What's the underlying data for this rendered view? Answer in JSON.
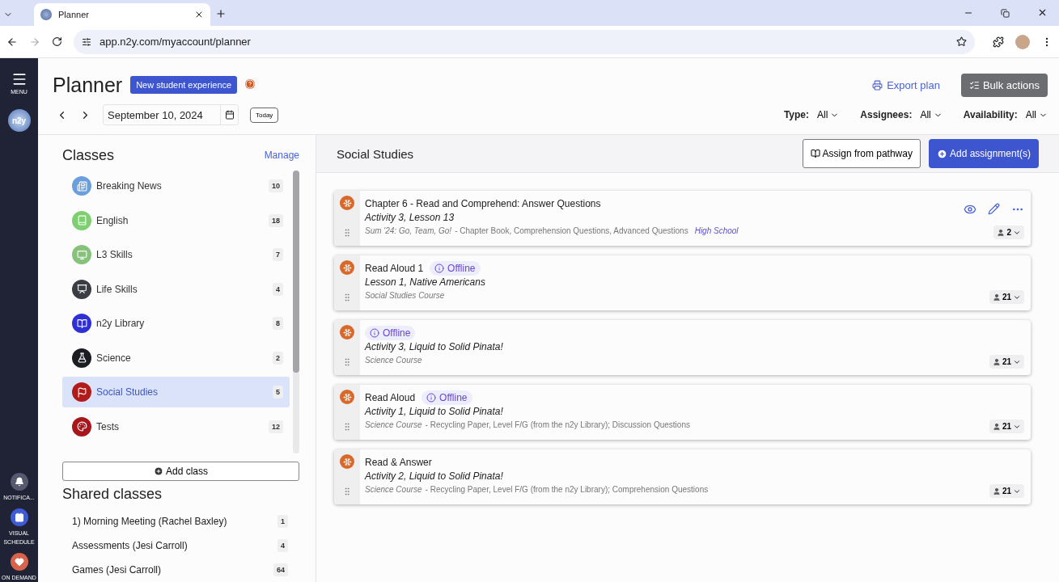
{
  "browser": {
    "tab_title": "Planner",
    "url": "app.n2y.com/myaccount/planner"
  },
  "rail": {
    "menu": "MENU",
    "logo": "n2y",
    "items": [
      {
        "label": "NOTIFICA...",
        "kind": "bell"
      },
      {
        "label": "VISUAL SCHEDULE",
        "kind": "calendar"
      },
      {
        "label": "ON DEMAND",
        "kind": "heart"
      }
    ]
  },
  "header": {
    "title": "Planner",
    "badge": "New student experience",
    "export": "Export plan",
    "bulk": "Bulk actions"
  },
  "date": {
    "value": "September 10, 2024",
    "today": "Today"
  },
  "filters": [
    {
      "label": "Type:",
      "value": "All"
    },
    {
      "label": "Assignees:",
      "value": "All"
    },
    {
      "label": "Availability:",
      "value": "All"
    }
  ],
  "classes": {
    "title": "Classes",
    "manage": "Manage",
    "add": "Add class",
    "items": [
      {
        "name": "Breaking News",
        "count": "10",
        "color": "#6a9fdc",
        "selected": false
      },
      {
        "name": "English",
        "count": "18",
        "color": "#7fcf72",
        "selected": false
      },
      {
        "name": "L3 Skills",
        "count": "7",
        "color": "#86c27a",
        "selected": false
      },
      {
        "name": "Life Skills",
        "count": "4",
        "color": "#3a3d44",
        "selected": false
      },
      {
        "name": "n2y Library",
        "count": "8",
        "color": "#2f2fd6",
        "selected": false
      },
      {
        "name": "Science",
        "count": "2",
        "color": "#1c1d22",
        "selected": false
      },
      {
        "name": "Social Studies",
        "count": "5",
        "color": "#b01c1c",
        "selected": true
      },
      {
        "name": "Tests",
        "count": "12",
        "color": "#a8161c",
        "selected": false
      }
    ]
  },
  "shared": {
    "title": "Shared classes",
    "items": [
      {
        "name": "1) Morning Meeting (Rachel Baxley)",
        "count": "1"
      },
      {
        "name": "Assessments (Jesi Carroll)",
        "count": "4"
      },
      {
        "name": "Games (Jesi Carroll)",
        "count": "64"
      }
    ]
  },
  "panel": {
    "title": "Social Studies",
    "pathway": "Assign from pathway",
    "add": "Add assignment(s)"
  },
  "assignments": [
    {
      "title": "Chapter 6 - Read and Comprehend: Answer Questions",
      "subtitle": "Activity 3, Lesson 13",
      "course": "Sum '24: Go, Team, Go!",
      "details": "- Chapter Book, Comprehension Questions, Advanced Questions",
      "tag": "High School",
      "assignees": "2",
      "actions": true
    },
    {
      "title": "Read Aloud 1",
      "badge": "Offline",
      "subtitle": "Lesson 1, Native Americans",
      "course": "Social Studies Course",
      "assignees": "21",
      "actions": false
    },
    {
      "badge": "Offline",
      "subtitle": "Activity 3, Liquid to Solid Pinata!",
      "course": "Science Course",
      "assignees": "21",
      "actions": false
    },
    {
      "title": "Read Aloud",
      "badge": "Offline",
      "subtitle": "Activity 1, Liquid to Solid Pinata!",
      "course": "Science Course",
      "details": "- Recycling Paper, Level F/G (from the n2y Library); Discussion Questions",
      "assignees": "21",
      "actions": false
    },
    {
      "title": "Read & Answer",
      "subtitle": "Activity 2, Liquid to Solid Pinata!",
      "course": "Science Course",
      "details": "- Recycling Paper, Level F/G (from the n2y Library); Comprehension Questions",
      "assignees": "21",
      "actions": false
    }
  ]
}
